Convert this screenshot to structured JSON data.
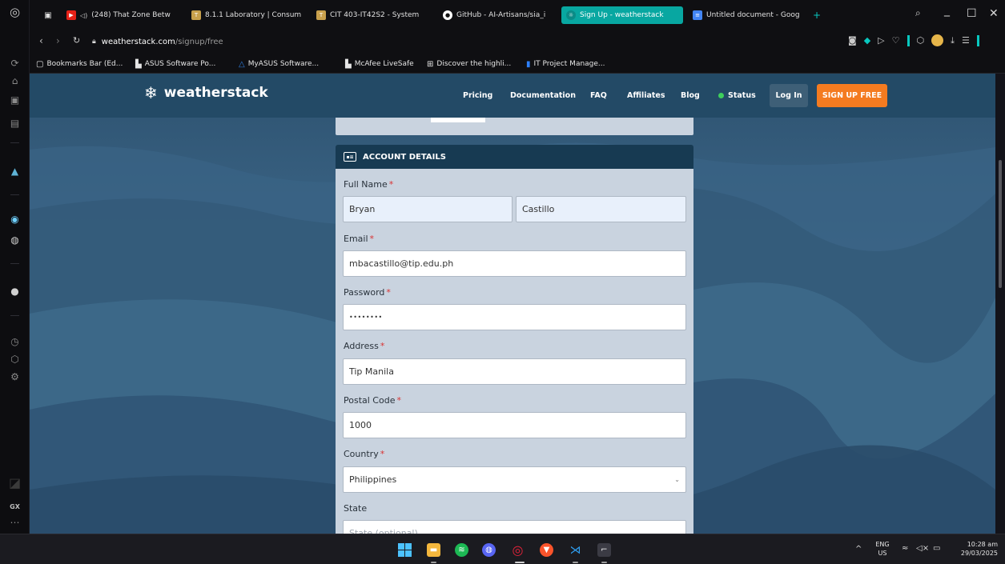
{
  "browser": {
    "tabs": [
      {
        "label": "(248) That Zone Betw",
        "icon": "youtube-icon"
      },
      {
        "label": "8.1.1 Laboratory | Consum",
        "icon": "tip-icon"
      },
      {
        "label": "CIT 403-IT42S2 - System",
        "icon": "tip-icon"
      },
      {
        "label": "GitHub - AI-Artisans/sia_i",
        "icon": "github-icon"
      },
      {
        "label": "Sign Up - weatherstack",
        "icon": "weatherstack-icon"
      },
      {
        "label": "Untitled document - Goog",
        "icon": "docs-icon"
      }
    ],
    "new_tab": "+",
    "url_host": "weatherstack.com",
    "url_path": "/signup/free",
    "bookmarks": [
      {
        "label": "Bookmarks Bar (Ed...",
        "icon": "folder-icon"
      },
      {
        "label": "ASUS Software Po...",
        "icon": "doc-icon"
      },
      {
        "label": "MyASUS Software...",
        "icon": "asus-icon"
      },
      {
        "label": "McAfee LiveSafe",
        "icon": "doc-icon"
      },
      {
        "label": "Discover the highli...",
        "icon": "grid-icon"
      },
      {
        "label": "IT Project Manage...",
        "icon": "trello-icon"
      }
    ]
  },
  "site": {
    "brand": "weatherstack",
    "nav": {
      "pricing": "Pricing",
      "documentation": "Documentation",
      "faq": "FAQ",
      "affiliates": "Affiliates",
      "blog": "Blog",
      "status": "Status",
      "login": "Log In",
      "signup": "SIGN UP FREE"
    }
  },
  "form": {
    "section_title": "ACCOUNT DETAILS",
    "required_mark": "*",
    "full_name_label": "Full Name",
    "first_name": "Bryan",
    "last_name": "Castillo",
    "email_label": "Email",
    "email": "mbacastillo@tip.edu.ph",
    "password_label": "Password",
    "password_mask": "••••••••",
    "address_label": "Address",
    "address": "Tip Manila",
    "postal_label": "Postal Code",
    "postal": "1000",
    "country_label": "Country",
    "country": "Philippines",
    "state_label": "State",
    "state_placeholder": "State (optional)"
  },
  "taskbar": {
    "lang": "ENG",
    "region": "US",
    "time": "10:28 am",
    "date": "29/03/2025"
  },
  "colors": {
    "accent_teal": "#08a7a1",
    "signup_orange": "#f47b20",
    "header_blue": "#234a66",
    "status_green": "#3ecf5c"
  }
}
